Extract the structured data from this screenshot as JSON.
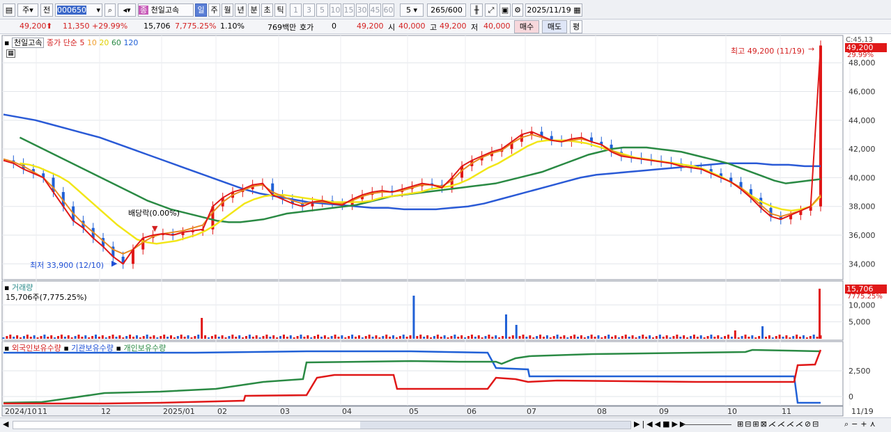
{
  "toolbar": {
    "type_label": "주",
    "prev_label": "전",
    "code": "000650",
    "name_badge": "종",
    "stock_name": "천일고속",
    "periods": [
      "일",
      "주",
      "월",
      "년",
      "분",
      "초",
      "틱"
    ],
    "active_period": "일",
    "intervals": [
      "1",
      "3",
      "5",
      "10",
      "15",
      "30",
      "45",
      "60"
    ],
    "interval_value": "5",
    "count": "265",
    "count_max": "/600",
    "date": "2025/11/19"
  },
  "quote": {
    "price": "49,200",
    "change": "11,350",
    "change_pct": "+29.99%",
    "volume": "15,706",
    "volume_pct": "7,775.25%",
    "turnover_pct": "1.10%",
    "amount": "769백만",
    "hoga_label": "호가",
    "hoga_value": "0",
    "hoga_price": "49,200",
    "open_label": "시",
    "open": "40,000",
    "high_label": "고",
    "high": "49,200",
    "low_label": "저",
    "low": "40,000",
    "buy": "매수",
    "sell": "매도",
    "eval": "평"
  },
  "legend": {
    "name": "천일고속",
    "close_label": "종가 단순",
    "ma": [
      "5",
      "10",
      "20",
      "60",
      "120"
    ],
    "volume_title": "거래량",
    "volume_info": "15,706주(7,775.25%)",
    "investor": [
      "외국인보유수량",
      "기관보유수량",
      "개인보유수량"
    ]
  },
  "annotations": {
    "high_note": "최고 49,200 (11/19)",
    "low_note": "최저 33,900 (12/10)",
    "dividend_note": "배당락(0.00%)",
    "right_price": "49,200",
    "right_pct": "29.99%",
    "c_label": "C:45,13",
    "vol_right": "15,706",
    "vol_right_pct": "7775.25%"
  },
  "chart_data": {
    "type": "line",
    "price_axis": [
      "48,000",
      "46,000",
      "44,000",
      "42,000",
      "40,000",
      "38,000",
      "36,000",
      "34,000"
    ],
    "volume_axis": [
      "10,000",
      "5,000"
    ],
    "investor_axis": [
      "2,500",
      "0"
    ],
    "x_labels": [
      "2024/10",
      "11",
      "12",
      "2025/01",
      "02",
      "03",
      "04",
      "05",
      "06",
      "07",
      "08",
      "09",
      "10",
      "11",
      "11/19"
    ],
    "close": [
      41200,
      41000,
      40600,
      40300,
      40000,
      39000,
      38000,
      37000,
      36500,
      35800,
      35200,
      34500,
      34000,
      35000,
      35800,
      36000,
      36100,
      36000,
      36200,
      36300,
      36400,
      38000,
      38600,
      39000,
      39200,
      39500,
      39600,
      38800,
      38500,
      38200,
      38000,
      38300,
      38400,
      38200,
      38100,
      38500,
      38800,
      39000,
      39100,
      39000,
      39200,
      39400,
      39600,
      39500,
      39300,
      40000,
      40800,
      41200,
      41500,
      41800,
      42000,
      42500,
      43000,
      43200,
      42900,
      42600,
      42500,
      42700,
      42800,
      42500,
      42300,
      41800,
      41500,
      41400,
      41300,
      41200,
      41100,
      41000,
      40800,
      40700,
      40600,
      40300,
      40000,
      39700,
      39200,
      38600,
      37900,
      37300,
      37100,
      37400,
      37700,
      38000,
      49200
    ],
    "ma5": [
      41300,
      41100,
      40800,
      40400,
      40000,
      39300,
      38400,
      37500,
      36800,
      36200,
      35600,
      35000,
      34700,
      35000,
      35500,
      35900,
      36100,
      36200,
      36300,
      36500,
      36700,
      37600,
      38300,
      38800,
      39100,
      39400,
      39500,
      39000,
      38700,
      38400,
      38200,
      38300,
      38300,
      38200,
      38200,
      38400,
      38700,
      38900,
      39000,
      39000,
      39100,
      39300,
      39500,
      39500,
      39400,
      39800,
      40500,
      41000,
      41400,
      41700,
      41900,
      42400,
      42800,
      43000,
      42800,
      42600,
      42500,
      42600,
      42700,
      42500,
      42300,
      41900,
      41600,
      41400,
      41300,
      41200,
      41100,
      41000,
      40800,
      40700,
      40600,
      40300,
      40000,
      39700,
      39300,
      38700,
      38100,
      37500,
      37300,
      37500,
      37700,
      38000,
      38800
    ],
    "ma20": [
      41000,
      40900,
      40700,
      40400,
      40100,
      39700,
      39100,
      38500,
      37900,
      37300,
      36700,
      36200,
      35700,
      35500,
      35400,
      35500,
      35600,
      35800,
      36000,
      36300,
      36700,
      37200,
      37700,
      38200,
      38500,
      38700,
      38800,
      38800,
      38700,
      38600,
      38500,
      38400,
      38300,
      38300,
      38300,
      38300,
      38400,
      38600,
      38700,
      38800,
      38900,
      39000,
      39200,
      39300,
      39400,
      39600,
      39900,
      40300,
      40700,
      41000,
      41400,
      41800,
      42200,
      42500,
      42600,
      42600,
      42600,
      42500,
      42400,
      42200,
      42000,
      41800,
      41600,
      41400,
      41300,
      41200,
      41100,
      41000,
      40900,
      40800,
      40600,
      40300,
      40000,
      39600,
      39200,
      38700,
      38300,
      38000,
      37800,
      37700,
      37800,
      38000,
      38700
    ],
    "ma60": [
      42800,
      42400,
      42000,
      41600,
      41200,
      40800,
      40400,
      40000,
      39600,
      39200,
      38800,
      38400,
      38100,
      37800,
      37600,
      37400,
      37200,
      37000,
      36900,
      36900,
      37000,
      37100,
      37300,
      37500,
      37600,
      37700,
      37800,
      37900,
      38000,
      38100,
      38300,
      38500,
      38700,
      38800,
      38900,
      39000,
      39100,
      39200,
      39300,
      39400,
      39500,
      39600,
      39800,
      40000,
      40200,
      40400,
      40700,
      41000,
      41300,
      41600,
      41800,
      42000,
      42100,
      42100,
      42100,
      42000,
      41900,
      41800,
      41600,
      41400,
      41200,
      41000,
      40700,
      40400,
      40100,
      39800,
      39600,
      39700,
      39800,
      39900
    ],
    "ma120": [
      44400,
      44200,
      44000,
      43700,
      43400,
      43100,
      42800,
      42400,
      42000,
      41600,
      41200,
      40800,
      40400,
      40000,
      39600,
      39200,
      38900,
      38700,
      38500,
      38300,
      38200,
      38100,
      38000,
      37900,
      37900,
      37800,
      37800,
      37800,
      37900,
      38000,
      38200,
      38500,
      38800,
      39100,
      39400,
      39700,
      40000,
      40200,
      40300,
      40400,
      40500,
      40600,
      40700,
      40800,
      40900,
      41000,
      41000,
      41000,
      40900,
      40900,
      40800,
      40800
    ]
  }
}
